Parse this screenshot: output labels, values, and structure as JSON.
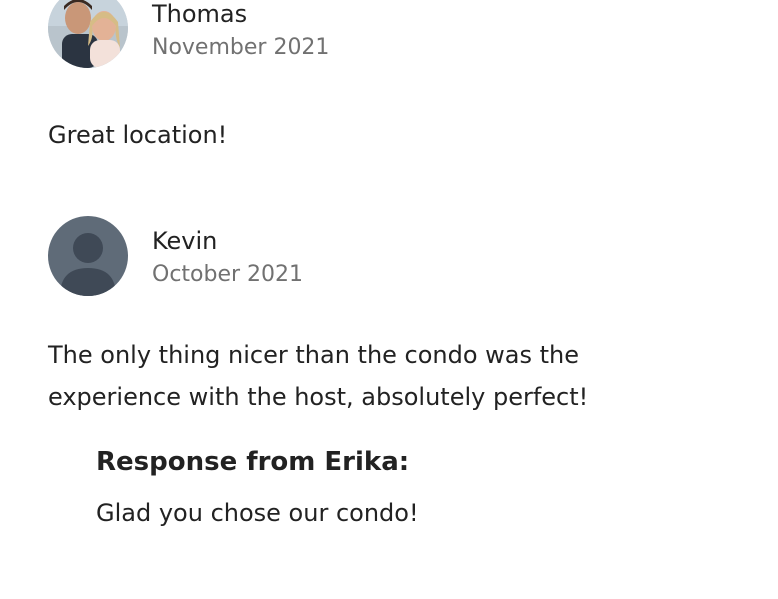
{
  "reviews": [
    {
      "name": "Thomas",
      "date": "November 2021",
      "text": "Great location!",
      "avatar_icon": "user-photo-icon"
    },
    {
      "name": "Kevin",
      "date": "October 2021",
      "text": "The only thing nicer than the condo was the experience with the host, absolutely perfect!",
      "avatar_icon": "default-user-icon",
      "response": {
        "title": "Response from Erika:",
        "text": "Glad you chose our condo!"
      }
    }
  ],
  "colors": {
    "primary_text": "#222222",
    "secondary_text": "#717171",
    "default_avatar_bg": "#5f6b78"
  }
}
